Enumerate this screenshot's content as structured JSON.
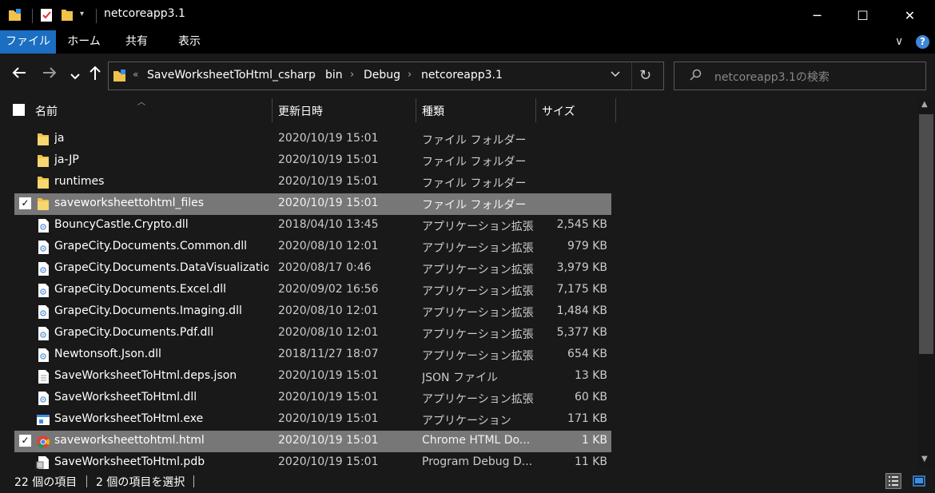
{
  "window": {
    "title": "netcoreapp3.1",
    "minimize": "─",
    "maximize": "☐",
    "close": "✕"
  },
  "ribbon": {
    "tabs": [
      "ファイル",
      "ホーム",
      "共有",
      "表示"
    ],
    "collapse_glyph": "∨",
    "help_glyph": "?"
  },
  "address": {
    "breadcrumbs": [
      "SaveWorksheetToHtml_csharp",
      "bin",
      "Debug",
      "netcoreapp3.1"
    ],
    "overflow_glyph": "«"
  },
  "search": {
    "placeholder": "netcoreapp3.1の検索"
  },
  "columns": {
    "name": "名前",
    "date": "更新日時",
    "type": "種類",
    "size": "サイズ"
  },
  "files": [
    {
      "name": "ja",
      "date": "2020/10/19 15:01",
      "type": "ファイル フォルダー",
      "size": "",
      "icon": "folder-icon",
      "selected": false
    },
    {
      "name": "ja-JP",
      "date": "2020/10/19 15:01",
      "type": "ファイル フォルダー",
      "size": "",
      "icon": "folder-icon",
      "selected": false
    },
    {
      "name": "runtimes",
      "date": "2020/10/19 15:01",
      "type": "ファイル フォルダー",
      "size": "",
      "icon": "folder-icon",
      "selected": false
    },
    {
      "name": "saveworksheettohtml_files",
      "date": "2020/10/19 15:01",
      "type": "ファイル フォルダー",
      "size": "",
      "icon": "folder-icon",
      "selected": true
    },
    {
      "name": "BouncyCastle.Crypto.dll",
      "date": "2018/04/10 13:45",
      "type": "アプリケーション拡張",
      "size": "2,545 KB",
      "icon": "dll-icon",
      "selected": false
    },
    {
      "name": "GrapeCity.Documents.Common.dll",
      "date": "2020/08/10 12:01",
      "type": "アプリケーション拡張",
      "size": "979 KB",
      "icon": "dll-icon",
      "selected": false
    },
    {
      "name": "GrapeCity.Documents.DataVisualizatio...",
      "date": "2020/08/17 0:46",
      "type": "アプリケーション拡張",
      "size": "3,979 KB",
      "icon": "dll-icon",
      "selected": false
    },
    {
      "name": "GrapeCity.Documents.Excel.dll",
      "date": "2020/09/02 16:56",
      "type": "アプリケーション拡張",
      "size": "7,175 KB",
      "icon": "dll-icon",
      "selected": false
    },
    {
      "name": "GrapeCity.Documents.Imaging.dll",
      "date": "2020/08/10 12:01",
      "type": "アプリケーション拡張",
      "size": "1,484 KB",
      "icon": "dll-icon",
      "selected": false
    },
    {
      "name": "GrapeCity.Documents.Pdf.dll",
      "date": "2020/08/10 12:01",
      "type": "アプリケーション拡張",
      "size": "5,377 KB",
      "icon": "dll-icon",
      "selected": false
    },
    {
      "name": "Newtonsoft.Json.dll",
      "date": "2018/11/27 18:07",
      "type": "アプリケーション拡張",
      "size": "654 KB",
      "icon": "dll-icon",
      "selected": false
    },
    {
      "name": "SaveWorksheetToHtml.deps.json",
      "date": "2020/10/19 15:01",
      "type": "JSON ファイル",
      "size": "13 KB",
      "icon": "json-file-icon",
      "selected": false
    },
    {
      "name": "SaveWorksheetToHtml.dll",
      "date": "2020/10/19 15:01",
      "type": "アプリケーション拡張",
      "size": "60 KB",
      "icon": "dll-icon",
      "selected": false
    },
    {
      "name": "SaveWorksheetToHtml.exe",
      "date": "2020/10/19 15:01",
      "type": "アプリケーション",
      "size": "171 KB",
      "icon": "exe-icon",
      "selected": false
    },
    {
      "name": "saveworksheettohtml.html",
      "date": "2020/10/19 15:01",
      "type": "Chrome HTML Do...",
      "size": "1 KB",
      "icon": "chrome-icon",
      "selected": true
    },
    {
      "name": "SaveWorksheetToHtml.pdb",
      "date": "2020/10/19 15:01",
      "type": "Program Debug D...",
      "size": "11 KB",
      "icon": "pdb-icon",
      "selected": false
    }
  ],
  "status": {
    "item_count": "22 個の項目",
    "selected_count": "2 個の項目を選択"
  },
  "colors": {
    "background": "#191919",
    "selected_row": "#777777",
    "accent": "#1b6ec2",
    "folder": "#f0c24a"
  }
}
